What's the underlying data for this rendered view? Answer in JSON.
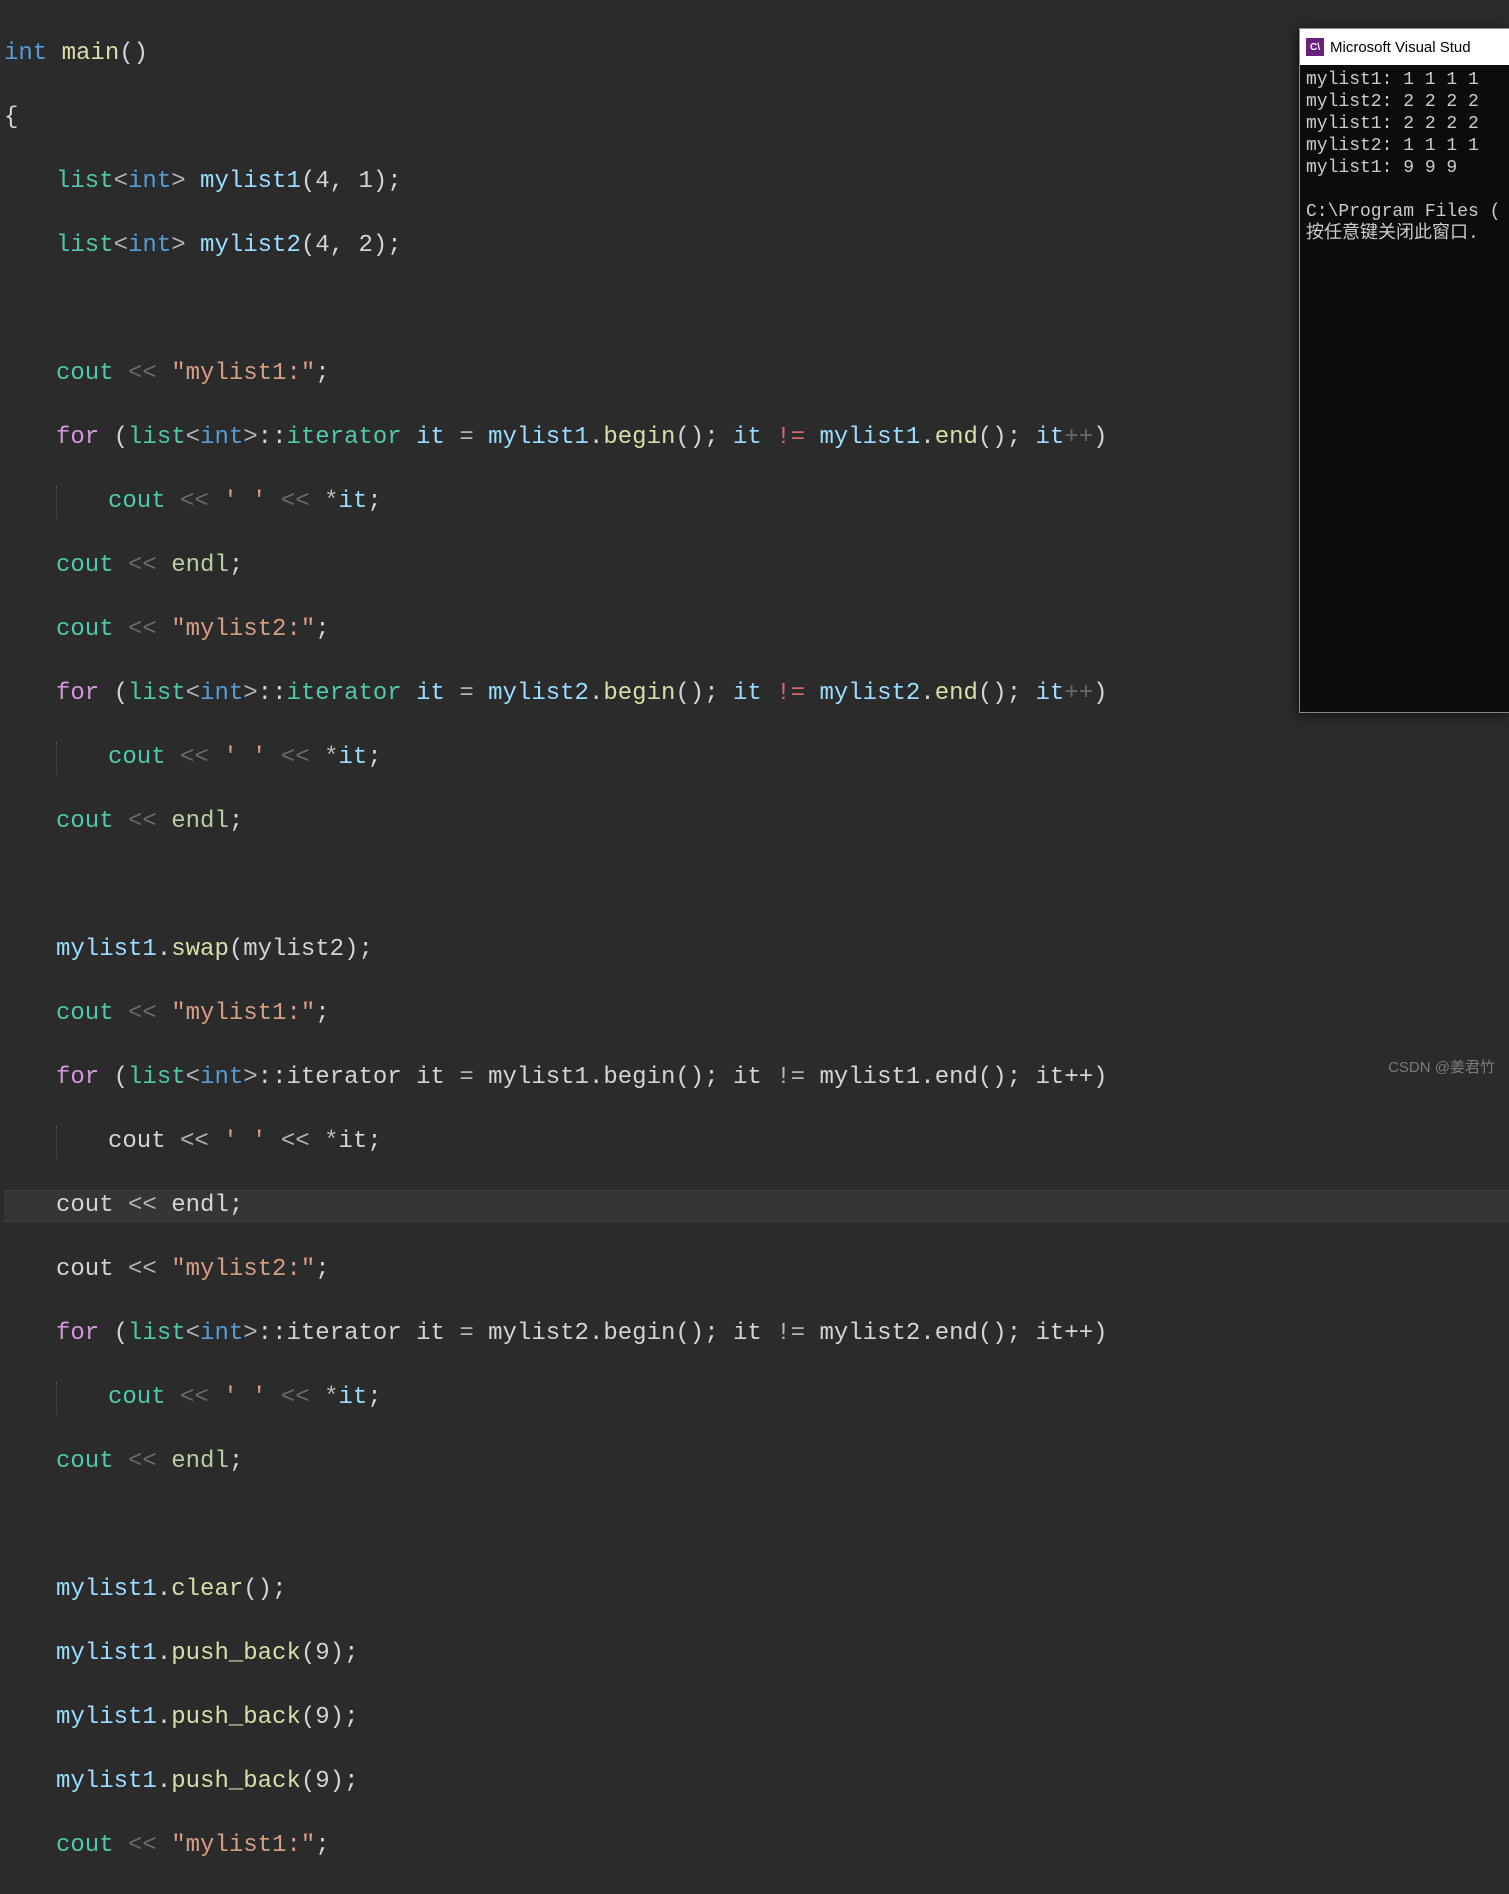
{
  "code": {
    "l1_int": "int",
    "l1_main": "main",
    "l1_par": "()",
    "l2_brace": "{",
    "list": "list",
    "int_tpl": "int",
    "mylist1": "mylist1",
    "mylist2": "mylist2",
    "args_41": "(4, 1)",
    "args_42": "(4, 2)",
    "semi": ";",
    "cout": "cout",
    "ltlt": "<<",
    "str_m1": "\"mylist1:\"",
    "str_m2": "\"mylist2:\"",
    "for": "for",
    "iterator": "iterator",
    "it": "it",
    "eq": "=",
    "dot": ".",
    "begin": "begin",
    "end": "end",
    "par_empty": "()",
    "ne": "!=",
    "itpp": "it++",
    "space_lit": "' '",
    "star_it": "*it",
    "endl": "endl",
    "swap": "swap",
    "swap_arg": "(mylist2)",
    "clear": "clear",
    "push_back": "push_back",
    "nine_arg": "(9)",
    "colon": "::",
    "lt": "<",
    "gt": ">",
    "lpar": "(",
    "rpar": ")"
  },
  "console": {
    "title": "Microsoft Visual Stud",
    "icon_text": "C\\",
    "lines": [
      "mylist1: 1 1 1 1",
      "mylist2: 2 2 2 2",
      "mylist1: 2 2 2 2",
      "mylist2: 1 1 1 1",
      "mylist1: 9 9 9",
      "",
      "C:\\Program Files (",
      "按任意键关闭此窗口."
    ]
  },
  "watermark": "CSDN @姜君竹"
}
